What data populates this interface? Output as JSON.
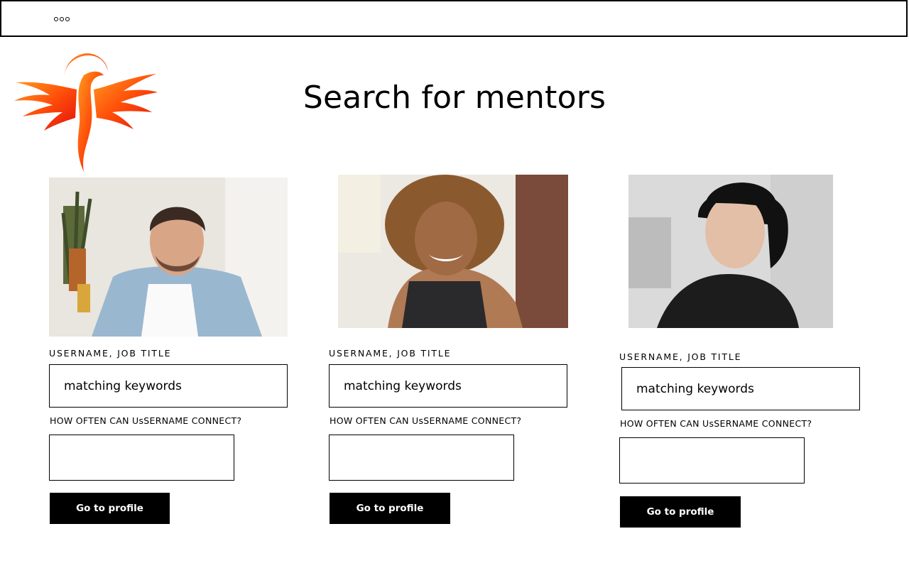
{
  "header": {
    "window_controls": [
      "dot",
      "dot",
      "dot"
    ]
  },
  "logo": {
    "icon": "phoenix-logo",
    "colors": [
      "#ff8c1a",
      "#ff3d00",
      "#e81b0c"
    ]
  },
  "page": {
    "title": "Search for mentors"
  },
  "mentors": [
    {
      "photo": "mentor-photo-man-denim-shirt",
      "field1_label": "USERNAME, JOB TITLE",
      "keywords_value": "matching keywords",
      "field2_label": "HOW OFTEN CAN UsSERNAME CONNECT?",
      "frequency_value": "",
      "button_label": "Go to profile"
    },
    {
      "photo": "mentor-photo-woman-curly-hair",
      "field1_label": "USERNAME, JOB TITLE",
      "keywords_value": "matching keywords",
      "field2_label": "HOW OFTEN CAN UsSERNAME CONNECT?",
      "frequency_value": "",
      "button_label": "Go to profile"
    },
    {
      "photo": "mentor-photo-woman-black-shirt",
      "field1_label": "USERNAME, JOB TITLE",
      "keywords_value": "matching keywords",
      "field2_label": "HOW OFTEN CAN UsSERNAME CONNECT?",
      "frequency_value": "",
      "button_label": "Go to profile"
    }
  ]
}
